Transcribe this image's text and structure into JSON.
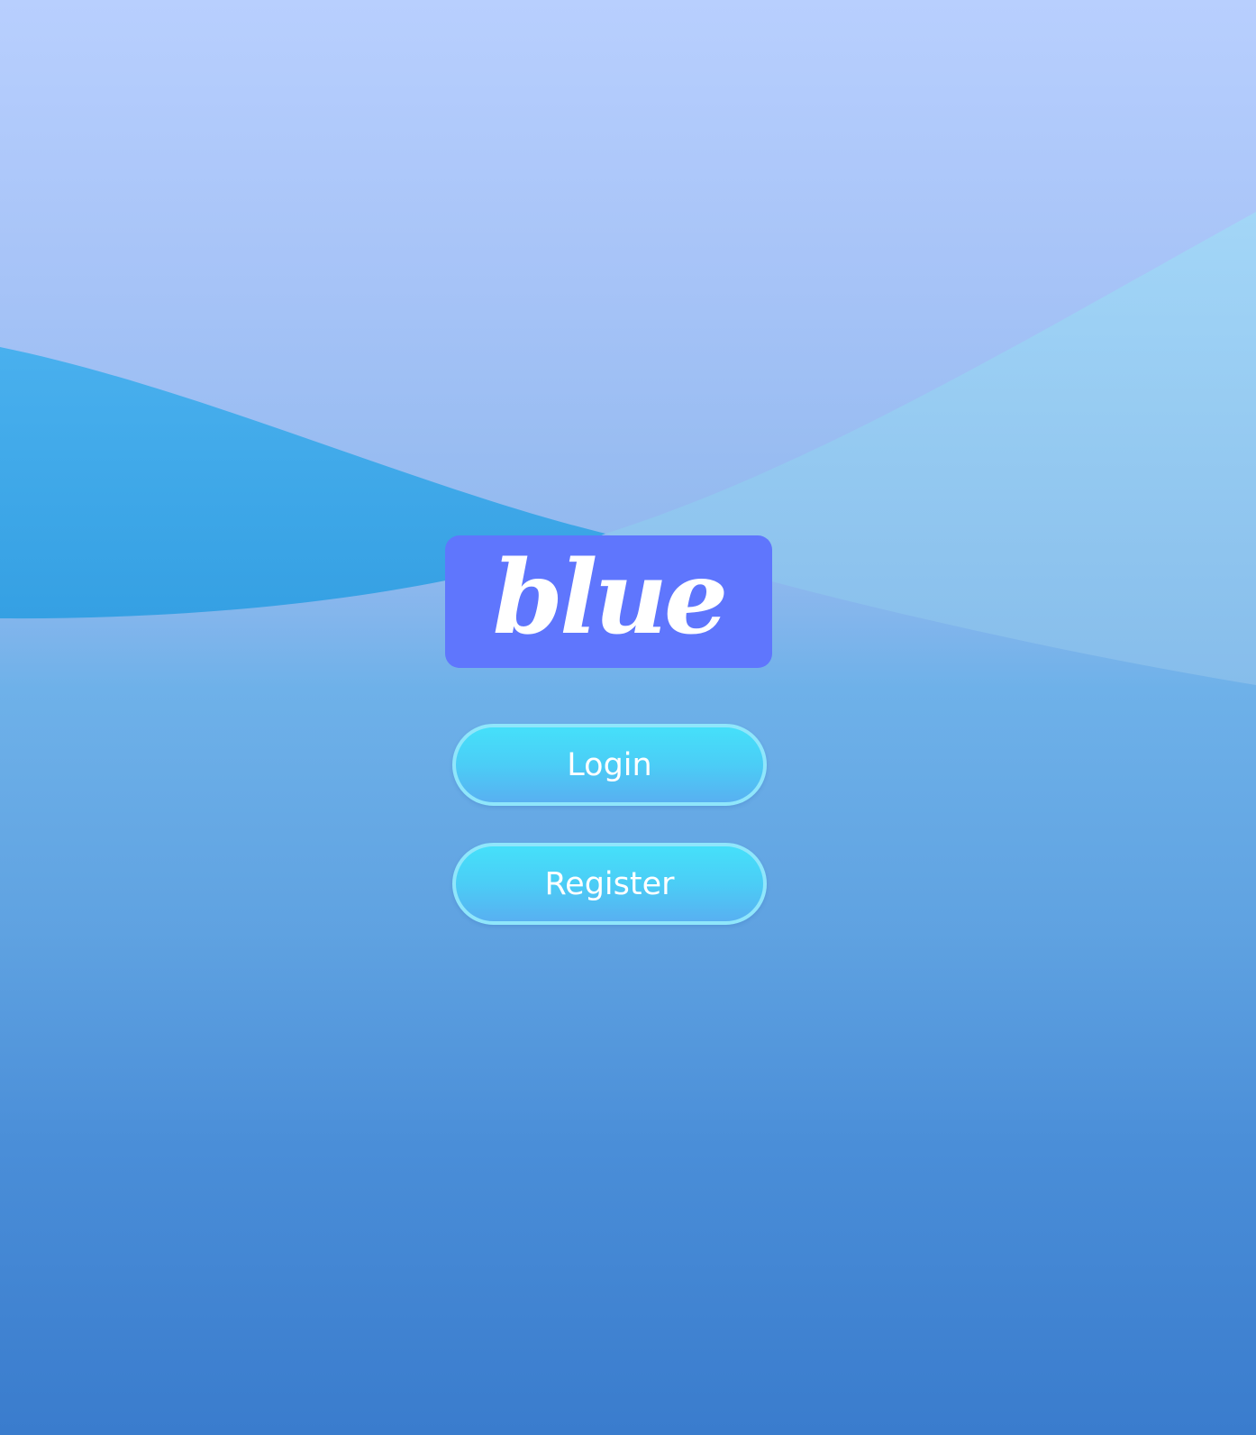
{
  "logo": {
    "text": "blue"
  },
  "actions": {
    "login_label": "Login",
    "register_label": "Register"
  },
  "colors": {
    "logo_background": "#5f76fd",
    "button_top": "#45e0fa",
    "button_bottom": "#58b0f1",
    "button_border": "#8fe6fb",
    "wave_dark": "#3fa8e8",
    "wave_light": "#a2d6f6"
  }
}
